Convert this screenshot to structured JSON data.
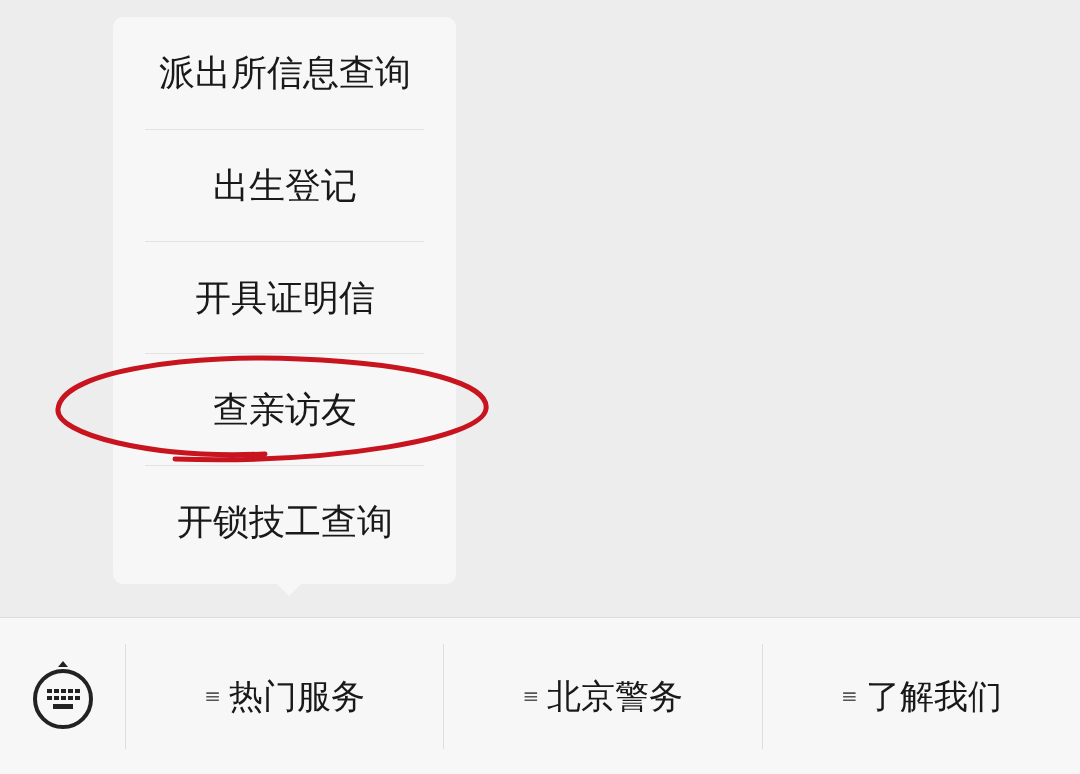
{
  "menu_popup": {
    "items": [
      {
        "label": "派出所信息查询",
        "circled": false
      },
      {
        "label": "出生登记",
        "circled": false
      },
      {
        "label": "开具证明信",
        "circled": false
      },
      {
        "label": "查亲访友",
        "circled": true
      },
      {
        "label": "开锁技工查询",
        "circled": false
      }
    ]
  },
  "bottom_menu": {
    "tabs": [
      {
        "icon": "≡",
        "label": "热门服务"
      },
      {
        "icon": "≡",
        "label": "北京警务"
      },
      {
        "icon": "≡",
        "label": "了解我们"
      }
    ]
  }
}
